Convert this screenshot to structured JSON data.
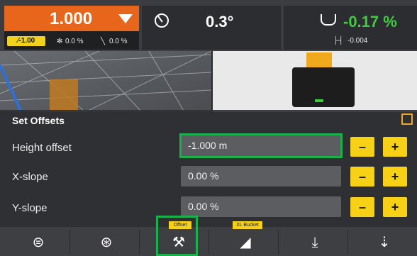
{
  "top": {
    "main_value": "1.000",
    "badge": "-1.00",
    "sub1": "0.0 %",
    "sub2": "0.0 %",
    "slope": "0.3°",
    "green_value": "-0.17 %",
    "dist": "-0.004"
  },
  "panel": {
    "title": "Set Offsets",
    "rows": [
      {
        "label": "Height offset",
        "value": "-1.000 m"
      },
      {
        "label": "X-slope",
        "value": "0.00 %"
      },
      {
        "label": "Y-slope",
        "value": "0.00 %"
      }
    ],
    "minus": "–",
    "plus": "+"
  },
  "bottom": {
    "offset_tag": "Offset",
    "xl_tag": "XL Bucket"
  },
  "colors": {
    "accent": "#e8651c",
    "highlight": "#1bb14a",
    "button": "#f6d116"
  }
}
